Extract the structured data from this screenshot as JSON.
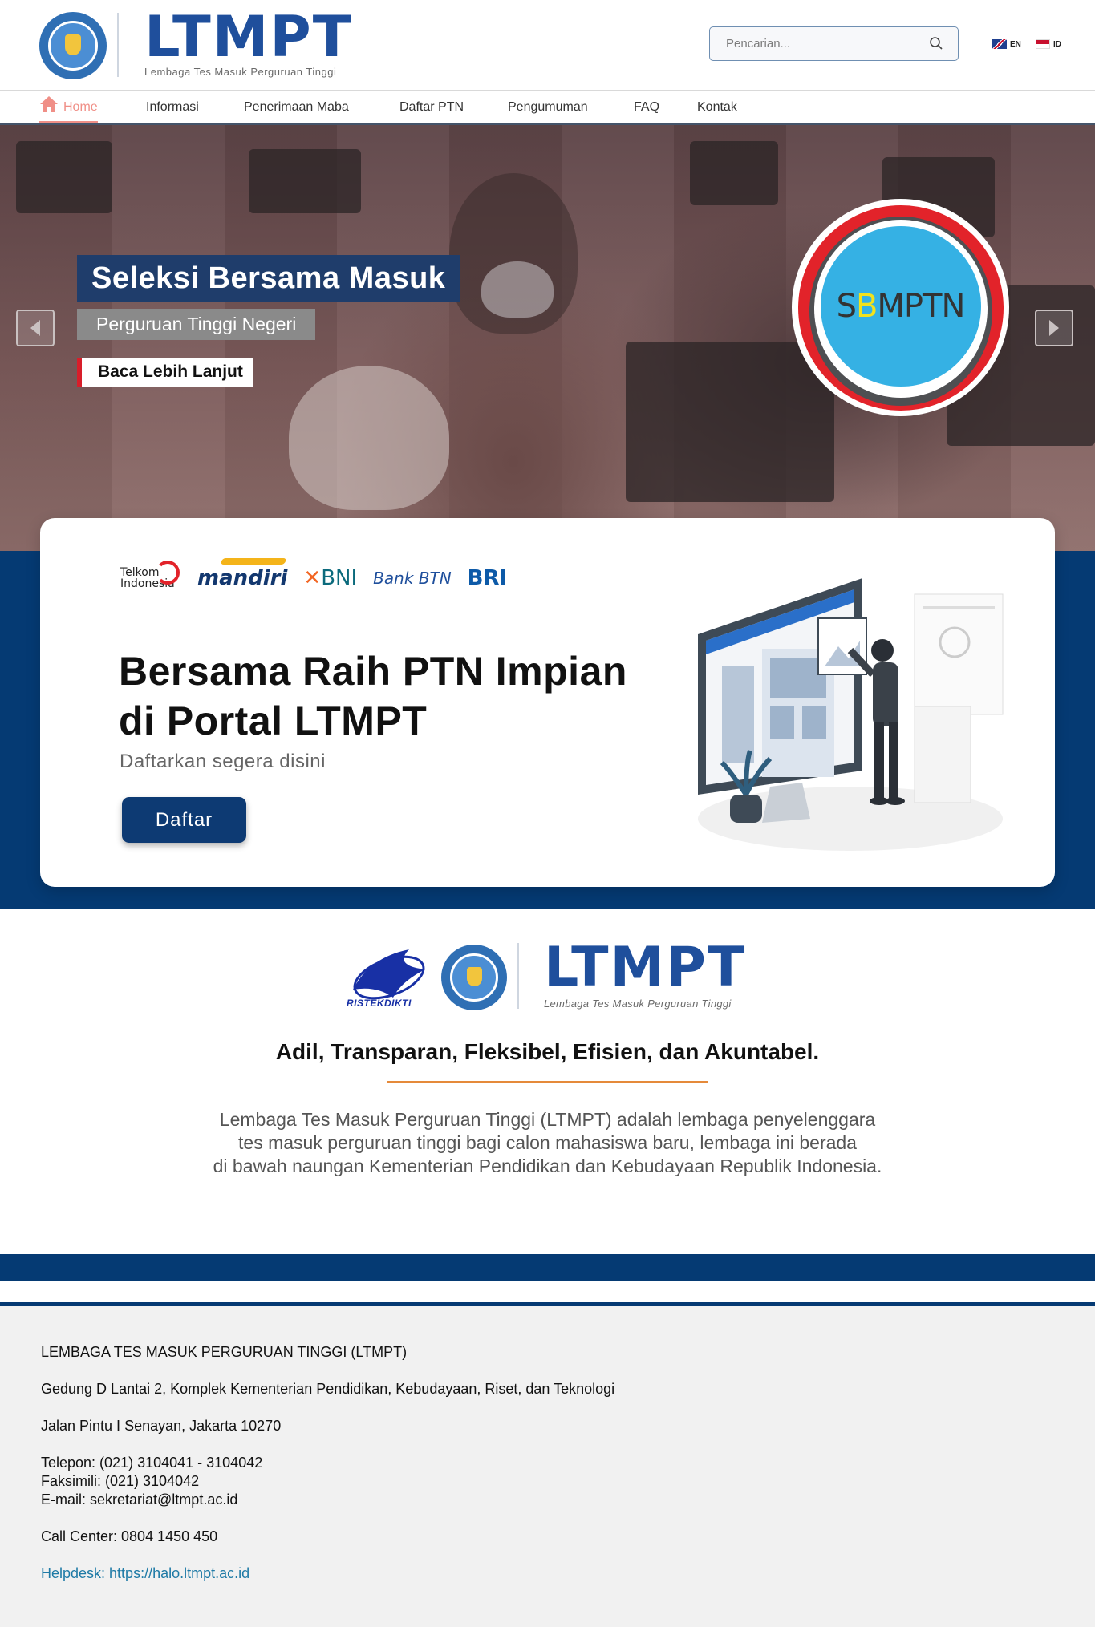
{
  "header": {
    "brand_name": "LTMPT",
    "brand_subtitle": "Lembaga Tes Masuk Perguruan Tinggi",
    "search_placeholder": "Pencarian...",
    "languages": [
      {
        "code": "EN",
        "icon": "uk-flag-icon"
      },
      {
        "code": "ID",
        "icon": "indonesia-flag-icon"
      }
    ]
  },
  "nav": {
    "items": [
      {
        "label": "Home",
        "active": true
      },
      {
        "label": "Informasi"
      },
      {
        "label": "Penerimaan Maba"
      },
      {
        "label": "Daftar PTN"
      },
      {
        "label": "Pengumuman"
      },
      {
        "label": "FAQ"
      },
      {
        "label": "Kontak"
      }
    ]
  },
  "hero": {
    "title": "Seleksi Bersama Masuk",
    "subtitle": "Perguruan Tinggi Negeri",
    "cta": "Baca Lebih Lanjut",
    "badge": {
      "prefix": "S",
      "highlight": "B",
      "suffix": "MPTN"
    }
  },
  "registration": {
    "partners": [
      "Telkom Indonesia",
      "mandiri",
      "BNI",
      "Bank BTN",
      "BRI"
    ],
    "title_line1": "Bersama Raih PTN Impian",
    "title_line2": "di Portal LTMPT",
    "subtitle": "Daftarkan segera disini",
    "button": "Daftar"
  },
  "about": {
    "ristek_label": "RISTEKDIKTI",
    "brand_name": "LTMPT",
    "brand_subtitle": "Lembaga Tes Masuk Perguruan Tinggi",
    "tagline": "Adil, Transparan, Fleksibel, Efisien, dan Akuntabel.",
    "description_lines": [
      "Lembaga Tes Masuk Perguruan Tinggi (LTMPT) adalah lembaga penyelenggara",
      "tes masuk perguruan tinggi bagi calon mahasiswa baru, lembaga ini berada",
      "di bawah naungan Kementerian Pendidikan dan Kebudayaan Republik Indonesia."
    ]
  },
  "footer": {
    "org": "LEMBAGA TES MASUK PERGURUAN TINGGI (LTMPT)",
    "address1": "Gedung D Lantai 2, Komplek Kementerian Pendidikan, Kebudayaan, Riset, dan Teknologi",
    "address2": "Jalan Pintu I Senayan, Jakarta 10270",
    "phone": "Telepon: (021) 3104041 - 3104042",
    "fax": "Faksimili: (021) 3104042",
    "email": "E-mail: sekretariat@ltmpt.ac.id",
    "call_center": "Call Center: 0804 1450 450",
    "helpdesk": "Helpdesk: https://halo.ltmpt.ac.id"
  },
  "colors": {
    "brand_blue": "#1f4f9c",
    "navy": "#053a73",
    "active_nav": "#f08f87",
    "accent_red": "#d81e2a",
    "tagline_rule": "#e58a3a"
  }
}
